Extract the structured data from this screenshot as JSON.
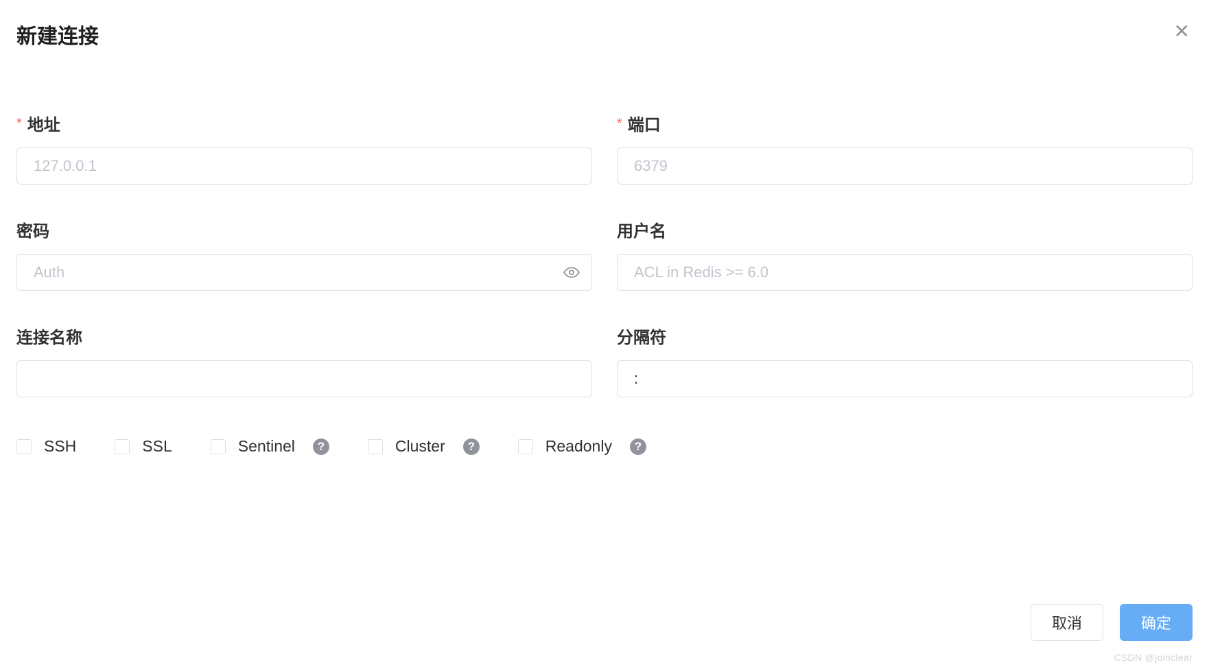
{
  "dialog": {
    "title": "新建连接"
  },
  "form": {
    "address": {
      "label": "地址",
      "placeholder": "127.0.0.1",
      "value": ""
    },
    "port": {
      "label": "端口",
      "placeholder": "6379",
      "value": ""
    },
    "password": {
      "label": "密码",
      "placeholder": "Auth",
      "value": ""
    },
    "username": {
      "label": "用户名",
      "placeholder": "ACL in Redis >= 6.0",
      "value": ""
    },
    "connection_name": {
      "label": "连接名称",
      "placeholder": "",
      "value": ""
    },
    "separator": {
      "label": "分隔符",
      "placeholder": "",
      "value": ":"
    }
  },
  "checkboxes": {
    "ssh": {
      "label": "SSH",
      "checked": false,
      "help": false
    },
    "ssl": {
      "label": "SSL",
      "checked": false,
      "help": false
    },
    "sentinel": {
      "label": "Sentinel",
      "checked": false,
      "help": true
    },
    "cluster": {
      "label": "Cluster",
      "checked": false,
      "help": true
    },
    "readonly": {
      "label": "Readonly",
      "checked": false,
      "help": true
    }
  },
  "footer": {
    "cancel_label": "取消",
    "confirm_label": "确定"
  },
  "watermark": "CSDN @joinclear"
}
